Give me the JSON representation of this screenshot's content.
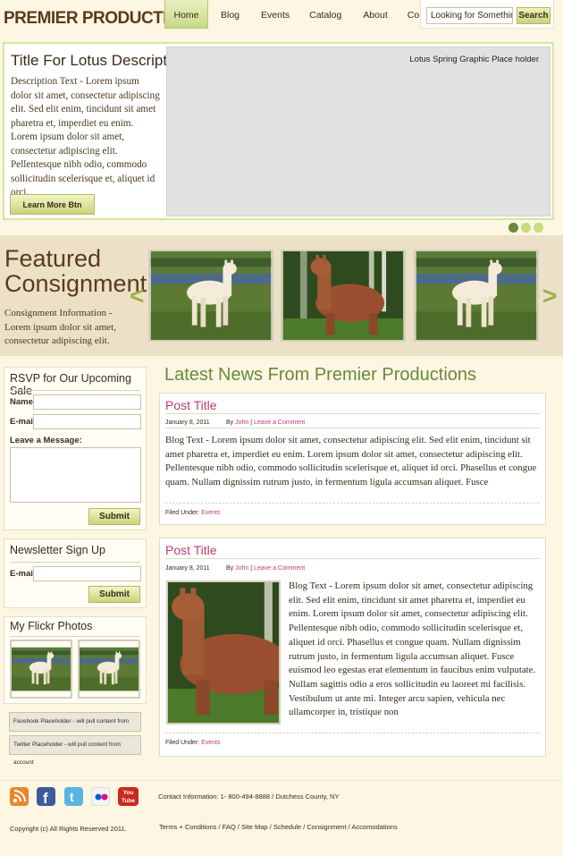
{
  "header": {
    "logo": "PREMIER PRODUCTIONS",
    "nav": [
      "Home",
      "Blog",
      "Events",
      "Catalog",
      "About",
      "Contact"
    ],
    "search_value": "Looking for Something?",
    "search_button": "Search"
  },
  "hero": {
    "title": "Title For Lotus Description",
    "text": "Description Text - Lorem ipsum dolor sit amet, consectetur adipiscing elit. Sed elit enim, tincidunt sit amet pharetra et, imperdiet eu enim. Lorem ipsum dolor sit amet, consectetur adipiscing elit. Pellentesque nibh odio, commodo sollicitudin scelerisque et, aliquet id orci.",
    "button": "Learn More Btn",
    "placeholder": "Lotus Spring Graphic Place holder"
  },
  "featured": {
    "title_line1": "Featured",
    "title_line2": "Consignment",
    "text": "Consignment Information - Lorem ipsum dolor sit amet, consectetur adipiscing elit.",
    "arrow_left": "<",
    "arrow_right": ">"
  },
  "sidebar": {
    "rsvp": {
      "title": "RSVP for Our Upcoming Sale",
      "name_label": "Name:",
      "email_label": "E-mail:",
      "message_label": "Leave a Message:",
      "submit": "Submit"
    },
    "newsletter": {
      "title": "Newsletter Sign Up",
      "email_label": "E-mail:",
      "submit": "Submit"
    },
    "flickr": {
      "title": "My Flickr Photos"
    },
    "facebook_placeholder": "Facebook Placeholder - will pull content from account",
    "twitter_placeholder": "Twitter Placeholder - will pull content from account"
  },
  "news": {
    "heading": "Latest News From Premier Productions",
    "posts": [
      {
        "title": "Post Title",
        "date": "January 8, 2011",
        "by": "By",
        "author": "John",
        "sep": "|",
        "comment": "Leave a Comment",
        "body": "Blog Text - Lorem ipsum dolor sit amet, consectetur adipiscing elit. Sed elit enim, tincidunt sit amet pharetra et, imperdiet eu enim. Lorem ipsum dolor sit amet, consectetur adipiscing elit. Pellentesque nibh odio, commodo sollicitudin scelerisque et, aliquet id orci. Phasellus et congue quam. Nullam dignissim rutrum justo, in fermentum ligula accumsan aliquet. Fusce",
        "filed_label": "Filed Under:",
        "filed_value": "Events"
      },
      {
        "title": "Post Title",
        "date": "January 8, 2011",
        "by": "By",
        "author": "John",
        "sep": "|",
        "comment": "Leave a Comment",
        "body": "Blog Text - Lorem ipsum dolor sit amet, consectetur adipiscing elit. Sed elit enim, tincidunt sit amet pharetra et, imperdiet eu enim. Lorem ipsum dolor sit amet, consectetur adipiscing elit. Pellentesque nibh odio, commodo sollicitudin scelerisque et, aliquet id orci. Phasellus et congue quam. Nullam dignissim rutrum justo, in fermentum ligula accumsan aliquet. Fusce euismod leo egestas erat elementum in faucibus enim vulputate. Nullam sagittis odio a eros sollicitudin eu laoreet mi facilisis. Vestibulum ut ante mi. Integer arcu sapien, vehicula nec ullamcorper in, tristique non",
        "filed_label": "Filed Under:",
        "filed_value": "Events"
      }
    ]
  },
  "footer": {
    "social_icons": [
      "rss-icon",
      "facebook-icon",
      "twitter-icon",
      "flickr-icon",
      "youtube-icon"
    ],
    "youtube_text": "You Tube",
    "contact": "Contact Information: 1- 800-494-8888 / Dutchess County, NY",
    "copyright": "Copyright (c) All Rights Reserved 2011.",
    "links": [
      "Terms + Conditions",
      "FAQ",
      "Site Map",
      "Schedule",
      "Consignment",
      "Accomodations"
    ],
    "link_sep": " / "
  },
  "colors": {
    "accent_green": "#6a8a3a",
    "link_pink": "#c03a78",
    "brand_brown": "#5a3a1c",
    "background": "#fcf6e3"
  }
}
